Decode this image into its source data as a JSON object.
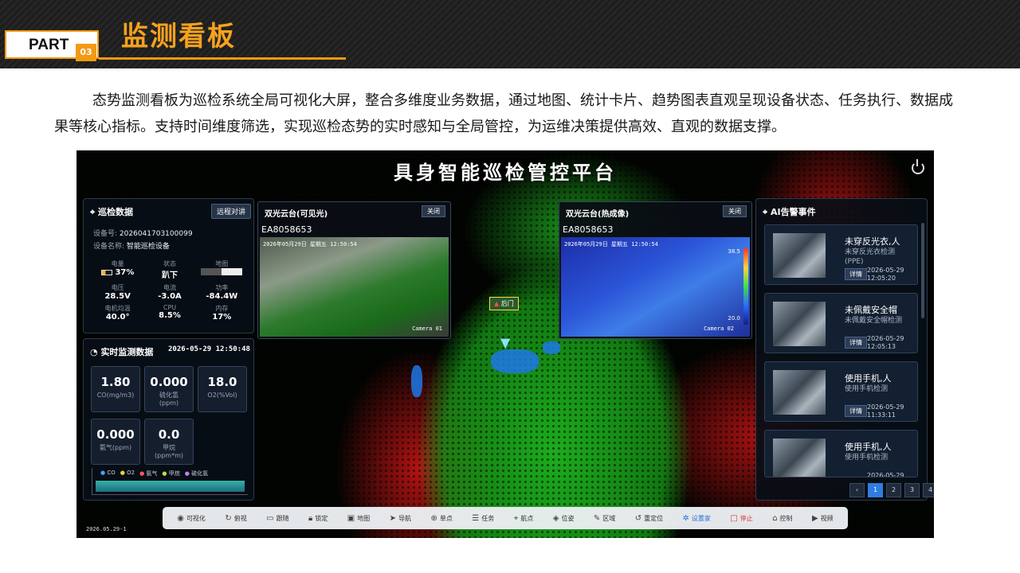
{
  "header": {
    "part_label": "PART",
    "part_number": "03",
    "section_title": "监测看板"
  },
  "intro_text": "态势监测看板为巡检系统全局可视化大屏，整合多维度业务数据，通过地图、统计卡片、趋势图表直观呈现设备状态、任务执行、数据成果等核心指标。支持时间维度筛选，实现巡检态势的实时感知与全局管控，为运维决策提供高效、直观的数据支撑。",
  "dashboard": {
    "title": "具身智能巡检管控平台",
    "patrol": {
      "heading": "巡检数据",
      "remote_button": "远程对讲",
      "device_no_label": "设备号:",
      "device_no": "2026041703100099",
      "device_name_label": "设备名称:",
      "device_name": "智能巡检设备",
      "stats": [
        {
          "label": "电量",
          "value": "37%"
        },
        {
          "label": "状态",
          "value": "趴下"
        },
        {
          "label": "地图",
          "value": ""
        },
        {
          "label": "电压",
          "value": "28.5V"
        },
        {
          "label": "电流",
          "value": "-3.0A"
        },
        {
          "label": "功率",
          "value": "-84.4W"
        },
        {
          "label": "电机均温",
          "value": "40.0°"
        },
        {
          "label": "CPU",
          "value": "8.5%"
        },
        {
          "label": "内存",
          "value": "17%"
        }
      ]
    },
    "realtime": {
      "heading": "实时监测数据",
      "timestamp": "2026-05-29 12:50:48",
      "metrics": [
        {
          "value": "1.80",
          "label": "CO(mg/m3)"
        },
        {
          "value": "0.000",
          "label": "硫化氢\n(ppm)"
        },
        {
          "value": "18.0",
          "label": "O2(%Vol)"
        },
        {
          "value": "0.000",
          "label": "氨气(ppm)"
        },
        {
          "value": "0.0",
          "label": "甲烷\n(ppm*m)"
        }
      ],
      "legend": [
        "CO",
        "O2",
        "氨气",
        "甲烷",
        "硫化氢"
      ],
      "legend_colors": [
        "#3fa7ff",
        "#f0d23a",
        "#ff5a5a",
        "#b2e04a",
        "#c77dff"
      ]
    },
    "camera_visible": {
      "heading": "双光云台(可见光)",
      "close": "关闭",
      "device_id": "EA8058653",
      "stamp": "2026年05月29日 星期五 12:50:54",
      "label": "Camera 01"
    },
    "camera_thermal": {
      "heading": "双光云台(热成像)",
      "close": "关闭",
      "device_id": "EA8058653",
      "stamp": "2026年05月29日 星期五 12:50:54",
      "label": "Camera 02",
      "temp_max": "38.5",
      "temp_min": "20.0"
    },
    "map_marker": "后门",
    "alerts": {
      "heading": "AI告警事件",
      "detail_label": "详情",
      "items": [
        {
          "title": "未穿反光衣,人",
          "sub": "未穿反光衣检测\n(PPE)",
          "date": "2026-05-29",
          "time": "12:05:20"
        },
        {
          "title": "未佩戴安全帽",
          "sub": "未佩戴安全帽检测",
          "date": "2026-05-29",
          "time": "12:05:13"
        },
        {
          "title": "使用手机,人",
          "sub": "使用手机检测",
          "date": "2026-05-29",
          "time": "11:33:11"
        },
        {
          "title": "使用手机,人",
          "sub": "使用手机检测",
          "date": "2026-05-29",
          "time": ""
        }
      ],
      "pages": [
        "1",
        "2",
        "3",
        "4",
        "5",
        "6",
        "...",
        "130"
      ]
    },
    "toolbar": [
      {
        "icon": "eye-icon",
        "glyph": "◉",
        "label": "可视化"
      },
      {
        "icon": "rotate-icon",
        "glyph": "↻",
        "label": "俯视"
      },
      {
        "icon": "camera-icon",
        "glyph": "▭",
        "label": "跟随"
      },
      {
        "icon": "lock-icon",
        "glyph": "🔒︎",
        "label": "锁定"
      },
      {
        "icon": "map-icon",
        "glyph": "▣",
        "label": "地图"
      },
      {
        "icon": "navigate-icon",
        "glyph": "➤",
        "label": "导航"
      },
      {
        "icon": "target-icon",
        "glyph": "⊕",
        "label": "单点"
      },
      {
        "icon": "task-icon",
        "glyph": "☰",
        "label": "任务"
      },
      {
        "icon": "pin-icon",
        "glyph": "⌖",
        "label": "航点"
      },
      {
        "icon": "pose-icon",
        "glyph": "◈",
        "label": "位姿"
      },
      {
        "icon": "pen-icon",
        "glyph": "✎",
        "label": "区域"
      },
      {
        "icon": "relocate-icon",
        "glyph": "↺",
        "label": "重定位"
      },
      {
        "icon": "settings-icon",
        "glyph": "✲",
        "label": "设置家"
      },
      {
        "icon": "stop-icon",
        "glyph": "□",
        "label": "停止"
      },
      {
        "icon": "gamepad-icon",
        "glyph": "⌂",
        "label": "控制"
      },
      {
        "icon": "video-icon",
        "glyph": "▶",
        "label": "视频"
      }
    ],
    "footer_date": "2026.05.29-1"
  }
}
